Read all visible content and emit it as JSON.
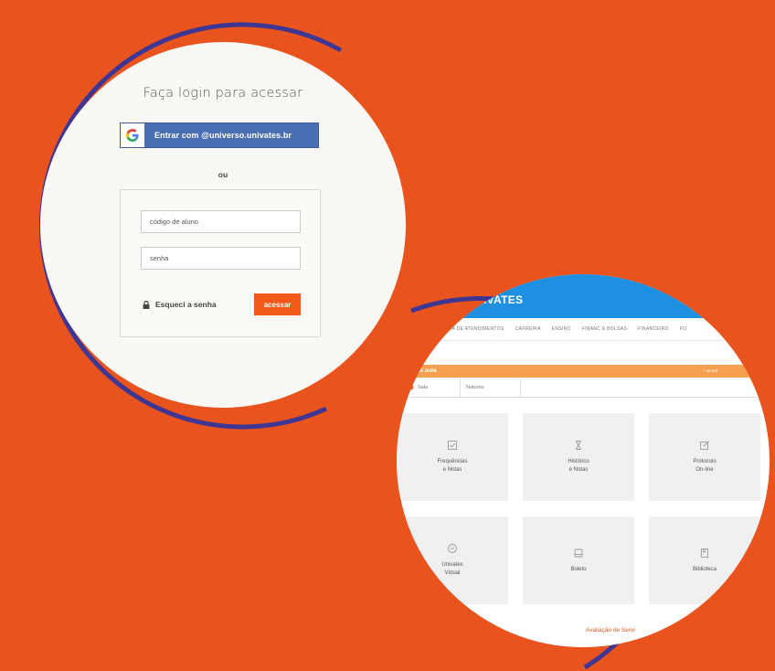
{
  "login": {
    "title": "Faça login para acessar",
    "google_button": "Entrar com @universo.univates.br",
    "or": "ou",
    "student_code_placeholder": "código de aluno",
    "password_placeholder": "senha",
    "forgot_password": "Esqueci a senha",
    "submit": "acessar"
  },
  "portal": {
    "brand": "NIVATES",
    "nav": [
      "GENDA DE ATENDIMENTOS",
      "CARREIRA",
      "ENSINO",
      "FINANC E BOLSAS",
      "FINANCEIRO",
      "FO"
    ],
    "next_class_bar": "óxima aula",
    "next_class_link": "+ ve tod",
    "room": "Sala",
    "shift": "Noturno",
    "cards": [
      {
        "label": "Frequências\ne Notas",
        "icon": "checklist-icon"
      },
      {
        "label": "Histórico\ne Notas",
        "icon": "hourglass-icon"
      },
      {
        "label": "Protocolo\nOn-line",
        "icon": "edit-icon"
      },
      {
        "label": "Univates\nVirtual",
        "icon": "globe-icon"
      },
      {
        "label": "Boleto",
        "icon": "barcode-icon"
      },
      {
        "label": "Biblioteca",
        "icon": "book-icon"
      }
    ],
    "evaluation_link": "Avaliação de Servi"
  },
  "colors": {
    "background": "#E9531E",
    "arc": "#3F3694",
    "google": "#4A6EB2",
    "submit": "#F25A1A",
    "portal_header": "#1E8FE1",
    "portal_bar": "#F5A050"
  }
}
